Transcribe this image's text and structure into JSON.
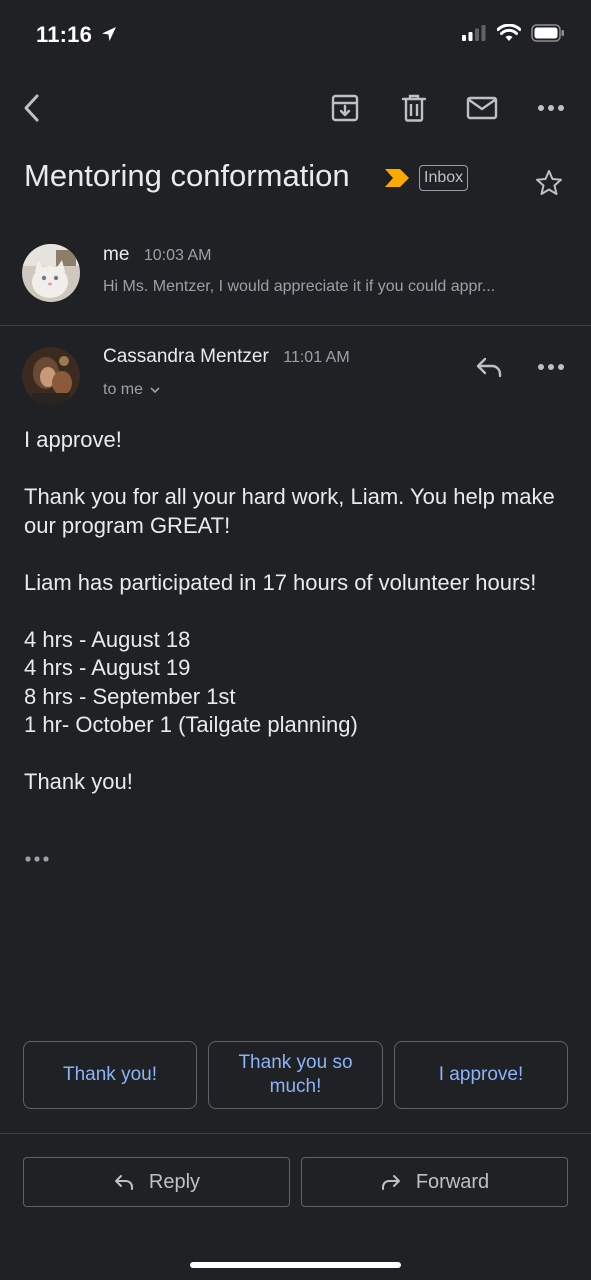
{
  "status_bar": {
    "time": "11:16"
  },
  "toolbar": {
    "icons": [
      "back-arrow-icon",
      "archive-icon",
      "trash-icon",
      "mark-unread-icon",
      "more-icon"
    ]
  },
  "email": {
    "subject": "Mentoring conformation",
    "label": "Inbox"
  },
  "messages": [
    {
      "sender": "me",
      "time": "10:03 AM",
      "snippet": "Hi Ms. Mentzer, I would appreciate it if you could appr..."
    },
    {
      "sender": "Cassandra Mentzer",
      "time": "11:01 AM",
      "recipient": "to me",
      "body": [
        "I approve!",
        "",
        "Thank you for all your hard work, Liam. You help make our program GREAT!",
        "",
        "Liam has participated in 17 hours of volunteer hours!",
        "",
        "4 hrs - August 18",
        "4 hrs - August 19",
        "8 hrs - September 1st",
        "1 hr- October 1 (Tailgate planning)",
        "",
        "Thank you!"
      ]
    }
  ],
  "smart_replies": [
    "Thank you!",
    "Thank you so much!",
    "I approve!"
  ],
  "actions": {
    "reply": "Reply",
    "forward": "Forward"
  },
  "colors": {
    "background": "#202124",
    "accent": "#8ab4f8",
    "importance": "#f9ab00",
    "text": "#e8eaed",
    "muted": "#9aa0a6"
  }
}
